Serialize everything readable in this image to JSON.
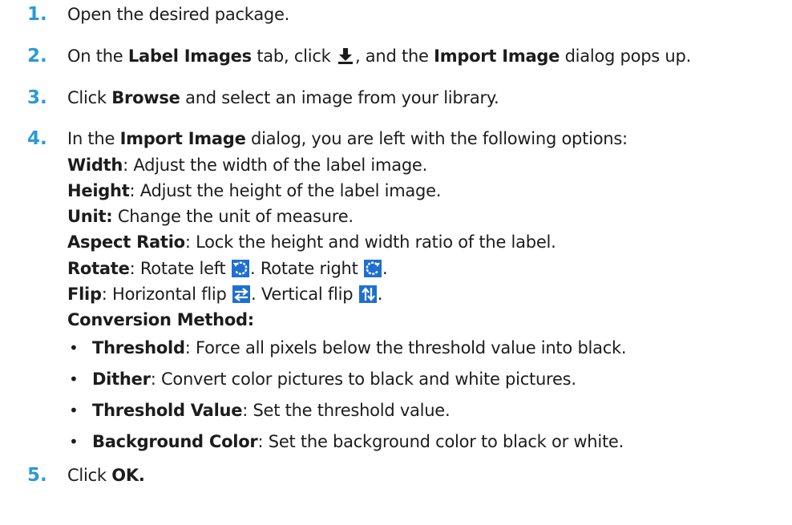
{
  "steps": [
    {
      "num": "1.",
      "text": "Open the desired package."
    },
    {
      "num": "2.",
      "pre": "On the ",
      "b1": "Label Images",
      "mid": " tab, click ",
      "icon": "download-icon",
      "post": ", and the ",
      "b2": "Import Image",
      "end": " dialog pops up."
    },
    {
      "num": "3.",
      "pre": "Click ",
      "b1": "Browse",
      "post": " and select an image from your library."
    },
    {
      "num": "4.",
      "pre": "In the ",
      "b1": "Import Image",
      "post": " dialog, you are left with the following options:"
    },
    {
      "num": "5.",
      "pre": "Click ",
      "b1": "OK."
    }
  ],
  "options": {
    "width": {
      "label": "Width",
      "text": ": Adjust the width of the label image."
    },
    "height": {
      "label": "Height",
      "text": ": Adjust the height of the label image."
    },
    "unit": {
      "label": "Unit:",
      "text": " Change the unit of measure."
    },
    "aspect": {
      "label": "Aspect Ratio",
      "text": ": Lock the height and width ratio of the label."
    },
    "rotate": {
      "label": "Rotate",
      "t1": ": Rotate left ",
      "t2": ". Rotate right ",
      "t3": ".",
      "icon_left": "rotate-left-icon",
      "icon_right": "rotate-right-icon"
    },
    "flip": {
      "label": "Flip",
      "t1": ": Horizontal flip ",
      "t2": ". Vertical flip ",
      "t3": ".",
      "icon_h": "horizontal-flip-icon",
      "icon_v": "vertical-flip-icon"
    },
    "conversion": {
      "label": "Conversion Method:"
    }
  },
  "conversion_items": [
    {
      "bullet": "•",
      "label": "Threshold",
      "text": ": Force all pixels below the threshold value into black."
    },
    {
      "bullet": "•",
      "label": "Dither",
      "text": ": Convert color pictures to black and white pictures."
    },
    {
      "bullet": "•",
      "label": "Threshold Value",
      "text": ": Set the threshold value."
    },
    {
      "bullet": "•",
      "label": "Background Color",
      "text": ": Set the background color to black or white."
    }
  ],
  "colors": {
    "step_number": "#2b9ad4",
    "icon_blue": "#1f6fd1",
    "text": "#1c1c1c"
  }
}
